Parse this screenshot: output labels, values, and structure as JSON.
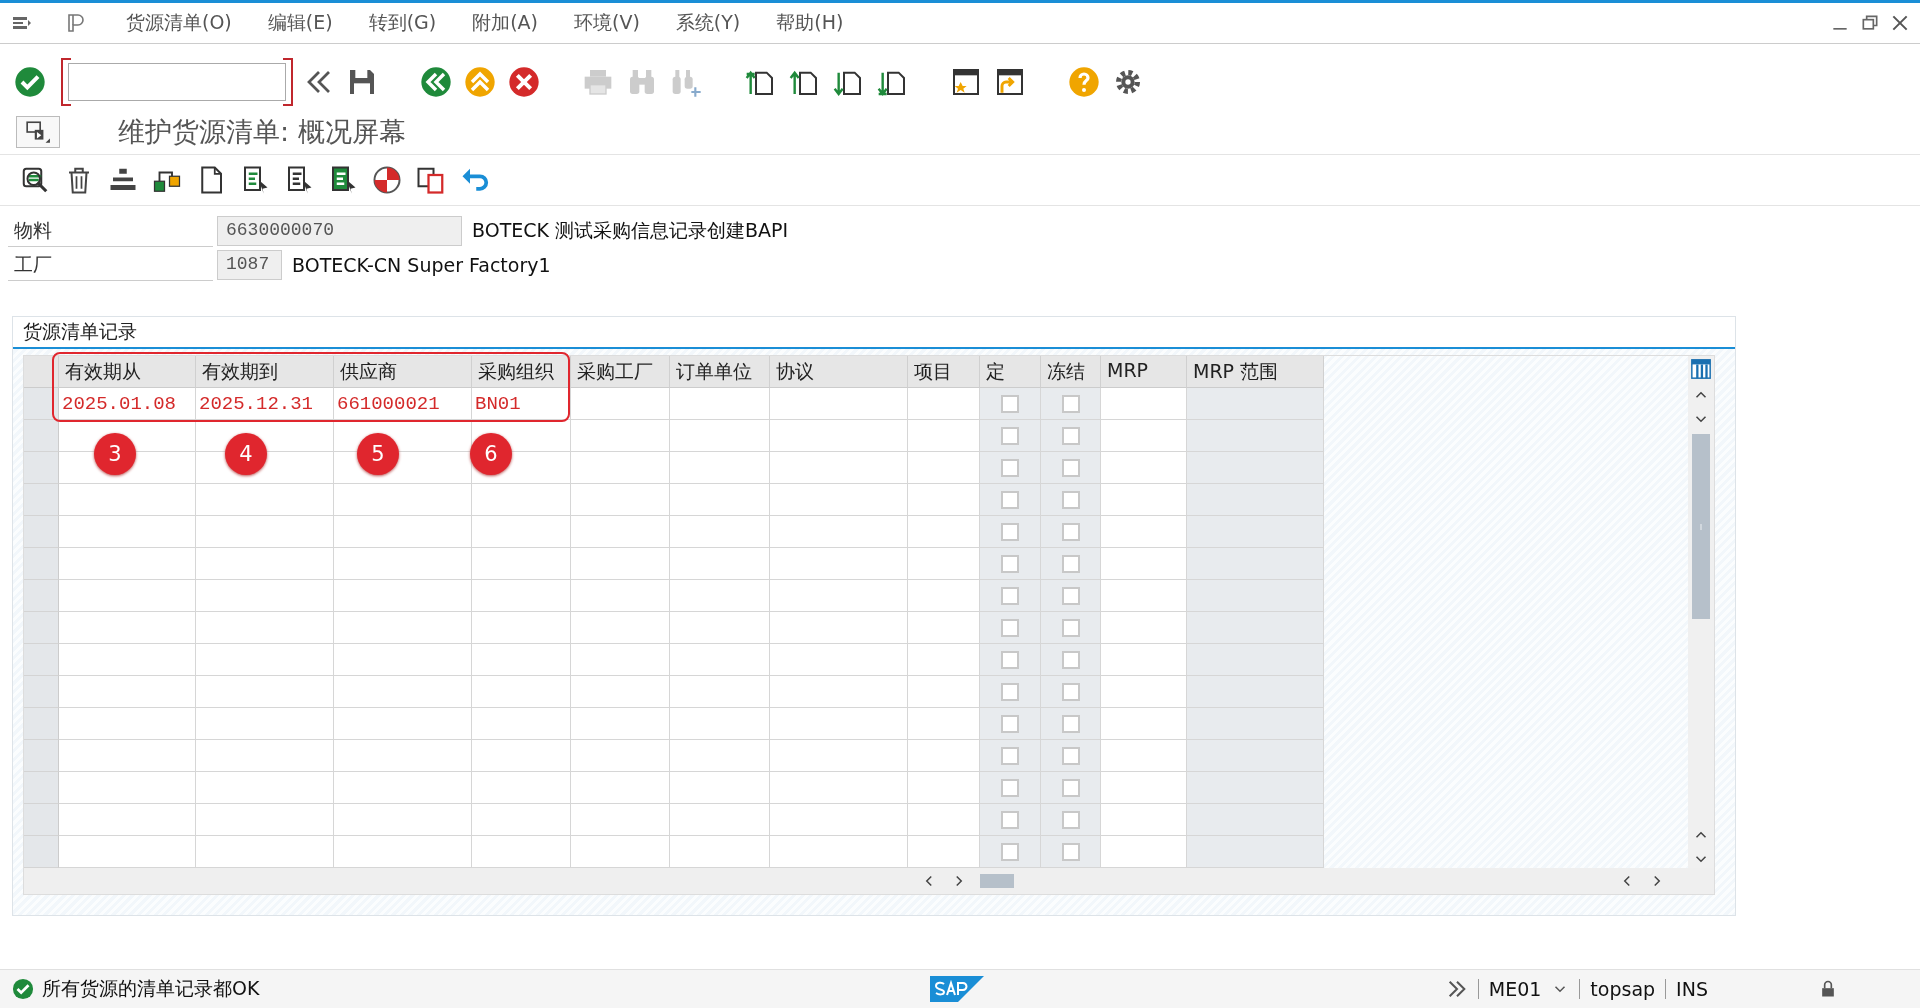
{
  "menu": [
    "货源清单(O)",
    "编辑(E)",
    "转到(G)",
    "附加(A)",
    "环境(V)",
    "系统(Y)",
    "帮助(H)"
  ],
  "title": "维护货源清单: 概况屏幕",
  "header_fields": [
    {
      "label": "物料",
      "value": "6630000070",
      "description": "BOTECK 测试采购信息记录创建BAPI"
    },
    {
      "label": "工厂",
      "value": "1087",
      "description": "BOTECK-CN Super Factory1"
    }
  ],
  "table": {
    "title": "货源清单记录",
    "columns": [
      "有效期从",
      "有效期到",
      "供应商",
      "采购组织",
      "采购工厂",
      "订单单位",
      "协议",
      "项目",
      "定",
      "冻结",
      "MRP",
      "MRP 范围"
    ],
    "rows": [
      {
        "cells": [
          "2025.01.08",
          "2025.12.31",
          "661000021",
          "BN01"
        ],
        "fixed": false,
        "frozen": false
      },
      {
        "fixed": false,
        "frozen": false
      },
      {
        "fixed": false,
        "frozen": false
      },
      {
        "fixed": false,
        "frozen": false
      },
      {
        "fixed": false,
        "frozen": false
      },
      {
        "fixed": false,
        "frozen": false
      },
      {
        "fixed": false,
        "frozen": false
      },
      {
        "fixed": false,
        "frozen": false
      },
      {
        "fixed": false,
        "frozen": false
      },
      {
        "fixed": false,
        "frozen": false
      },
      {
        "fixed": false,
        "frozen": false
      },
      {
        "fixed": false,
        "frozen": false
      },
      {
        "fixed": false,
        "frozen": false
      },
      {
        "fixed": false,
        "frozen": false
      },
      {
        "fixed": false,
        "frozen": false
      }
    ]
  },
  "annotations": [
    "3",
    "4",
    "5",
    "6"
  ],
  "status_bar": {
    "message": "所有货源的清单记录都OK",
    "transaction": "ME01",
    "user": "topsap",
    "mode": "INS"
  }
}
